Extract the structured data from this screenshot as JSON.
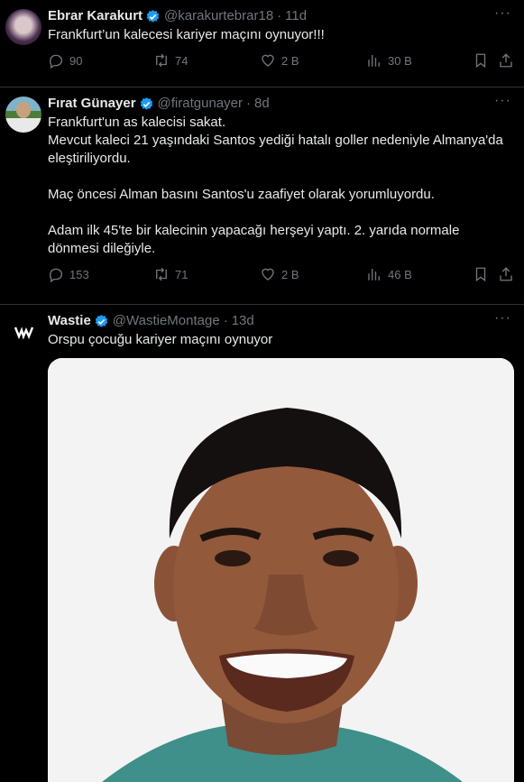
{
  "tweets": [
    {
      "name": "Ebrar Karakurt",
      "handle": "@karakurtebrar18",
      "time": "11d",
      "text": "Frankfurt’un kalecesi kariyer maçını oynuyor!!!",
      "replies": "90",
      "retweets": "74",
      "likes": "2 B",
      "views": "30 B"
    },
    {
      "name": "Fırat Günayer",
      "handle": "@firatgunayer",
      "time": "8d",
      "text": "Frankfurt'un as kalecisi sakat.\nMevcut kaleci 21 yaşındaki Santos yediği hatalı goller nedeniyle Almanya'da eleştiriliyordu.\n\nMaç öncesi Alman basını Santos'u zaafiyet olarak yorumluyordu.\n\nAdam ilk 45'te bir kalecinin yapacağı herşeyi yaptı. 2. yarıda normale dönmesi dileğiyle.",
      "replies": "153",
      "retweets": "71",
      "likes": "2 B",
      "views": "46 B"
    },
    {
      "name": "Wastie",
      "handle": "@WastieMontage",
      "time": "13d",
      "text": "Orspu çocuğu kariyer maçını oynuyor"
    }
  ],
  "separator": "·",
  "more_glyph": "···",
  "colors": {
    "background": "#000000",
    "muted": "#71767b",
    "verified": "#1d9bf0",
    "text": "#e7e9ea"
  }
}
